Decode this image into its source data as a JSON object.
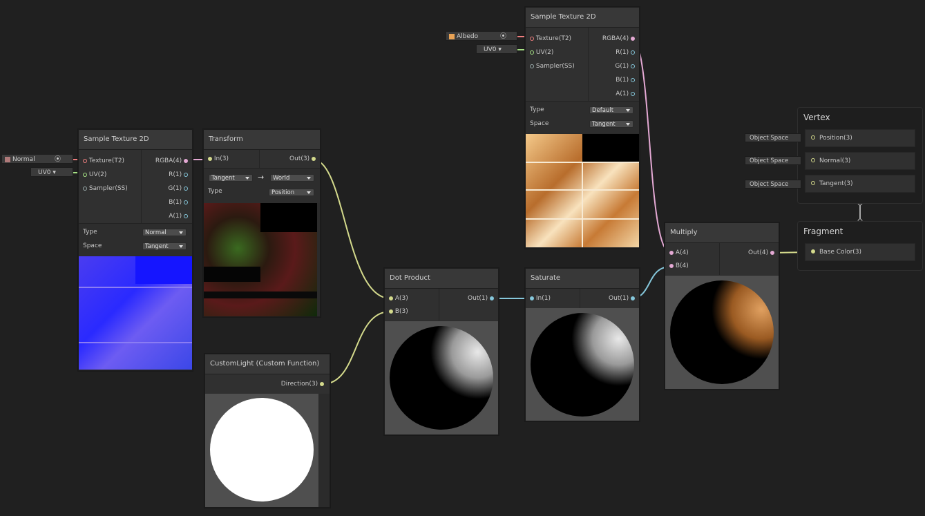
{
  "nodes": {
    "sample_normal": {
      "title": "Sample Texture 2D",
      "inputs": [
        "Texture(T2)",
        "UV(2)",
        "Sampler(SS)"
      ],
      "outputs": [
        "RGBA(4)",
        "R(1)",
        "G(1)",
        "B(1)",
        "A(1)"
      ],
      "type_label": "Type",
      "type_value": "Normal",
      "space_label": "Space",
      "space_value": "Tangent",
      "texture_field": "Normal",
      "uv_field": "UV0"
    },
    "sample_albedo": {
      "title": "Sample Texture 2D",
      "inputs": [
        "Texture(T2)",
        "UV(2)",
        "Sampler(SS)"
      ],
      "outputs": [
        "RGBA(4)",
        "R(1)",
        "G(1)",
        "B(1)",
        "A(1)"
      ],
      "type_label": "Type",
      "type_value": "Default",
      "space_label": "Space",
      "space_value": "Tangent",
      "texture_field": "Albedo",
      "uv_field": "UV0"
    },
    "transform": {
      "title": "Transform",
      "input": "In(3)",
      "output": "Out(3)",
      "from_space": "Tangent",
      "arrow": "→",
      "to_space": "World",
      "type_label": "Type",
      "type_value": "Position"
    },
    "custom_light": {
      "title": "CustomLight (Custom Function)",
      "output": "Direction(3)"
    },
    "dot_product": {
      "title": "Dot Product",
      "input_a": "A(3)",
      "input_b": "B(3)",
      "output": "Out(1)"
    },
    "saturate": {
      "title": "Saturate",
      "input": "In(1)",
      "output": "Out(1)"
    },
    "multiply": {
      "title": "Multiply",
      "input_a": "A(4)",
      "input_b": "B(4)",
      "output": "Out(4)"
    }
  },
  "master": {
    "vertex": {
      "title": "Vertex",
      "slots": [
        {
          "label": "Position(3)",
          "space": "Object Space"
        },
        {
          "label": "Normal(3)",
          "space": "Object Space"
        },
        {
          "label": "Tangent(3)",
          "space": "Object Space"
        }
      ]
    },
    "fragment": {
      "title": "Fragment",
      "slots": [
        {
          "label": "Base Color(3)"
        }
      ]
    }
  },
  "colors": {
    "background": "#202020",
    "wire_vector3": "#d4da8c",
    "wire_vector4": "#e4a9d4",
    "wire_float": "#86c8dc",
    "wire_texture": "#ef7e7e",
    "wire_uv": "#a6e285"
  }
}
